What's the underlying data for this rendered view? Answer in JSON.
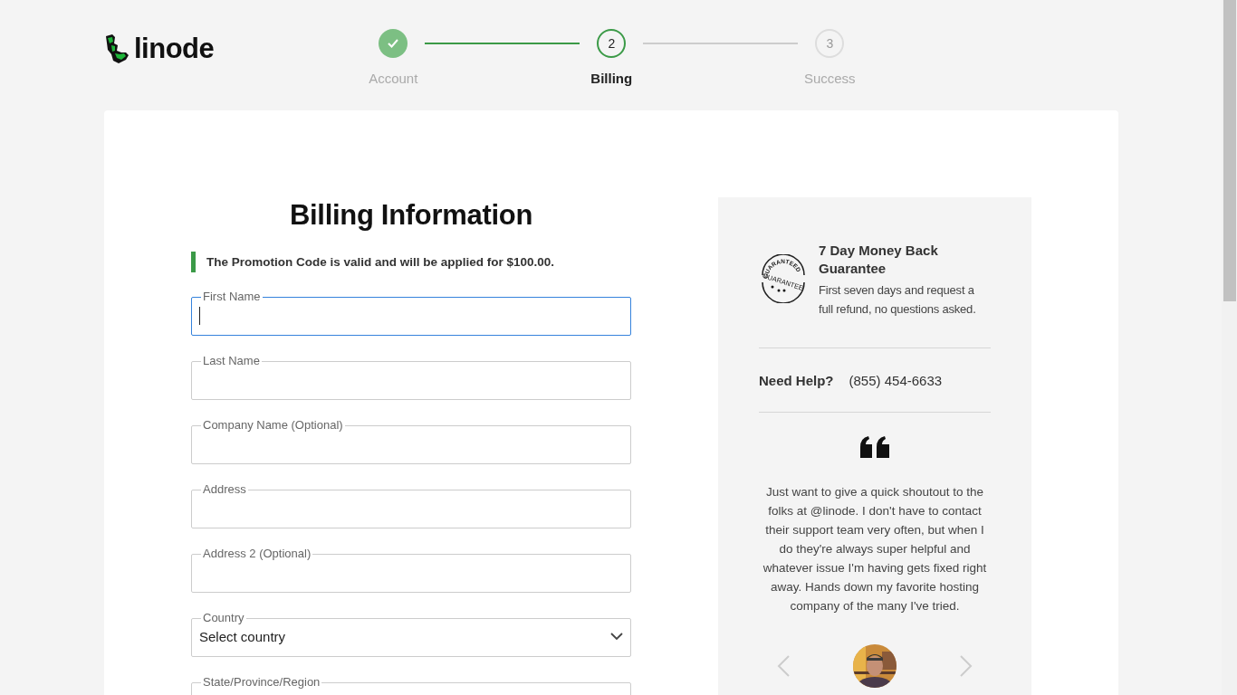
{
  "logo": {
    "text": "linode"
  },
  "steps": [
    {
      "label": "Account",
      "done": true,
      "selected": false
    },
    {
      "label": "Billing",
      "number": "2",
      "done": false,
      "selected": true
    },
    {
      "label": "Success",
      "number": "3",
      "done": false,
      "selected": false
    }
  ],
  "heading": "Billing Information",
  "notice": "The Promotion Code is valid and will be applied for $100.00.",
  "fields": [
    {
      "kind": "text",
      "label": "First Name",
      "focused": true
    },
    {
      "kind": "text",
      "label": "Last Name",
      "focused": false
    },
    {
      "kind": "text",
      "label": "Company Name (Optional)",
      "focused": false
    },
    {
      "kind": "text",
      "label": "Address",
      "focused": false
    },
    {
      "kind": "text",
      "label": "Address 2 (Optional)",
      "focused": false
    },
    {
      "kind": "select",
      "label": "Country",
      "value": "Select country",
      "focused": false
    },
    {
      "kind": "text",
      "label": "State/Province/Region",
      "focused": false
    }
  ],
  "guarantee": {
    "stamp_arc": "GUARANTEED",
    "stamp_text": "GUARANTEE",
    "title": "7 Day Money Back Guarantee",
    "text": "First seven days and request a full refund, no questions asked."
  },
  "help": {
    "label": "Need Help?",
    "phone": "(855) 454-6633"
  },
  "testimonial": {
    "quote": "Just want to give a quick shoutout to the folks at @linode. I don't have to contact their support team very often, but when I do they're always super helpful and whatever issue I'm having gets fixed right away. Hands down my favorite hosting company of the many I've tried."
  }
}
